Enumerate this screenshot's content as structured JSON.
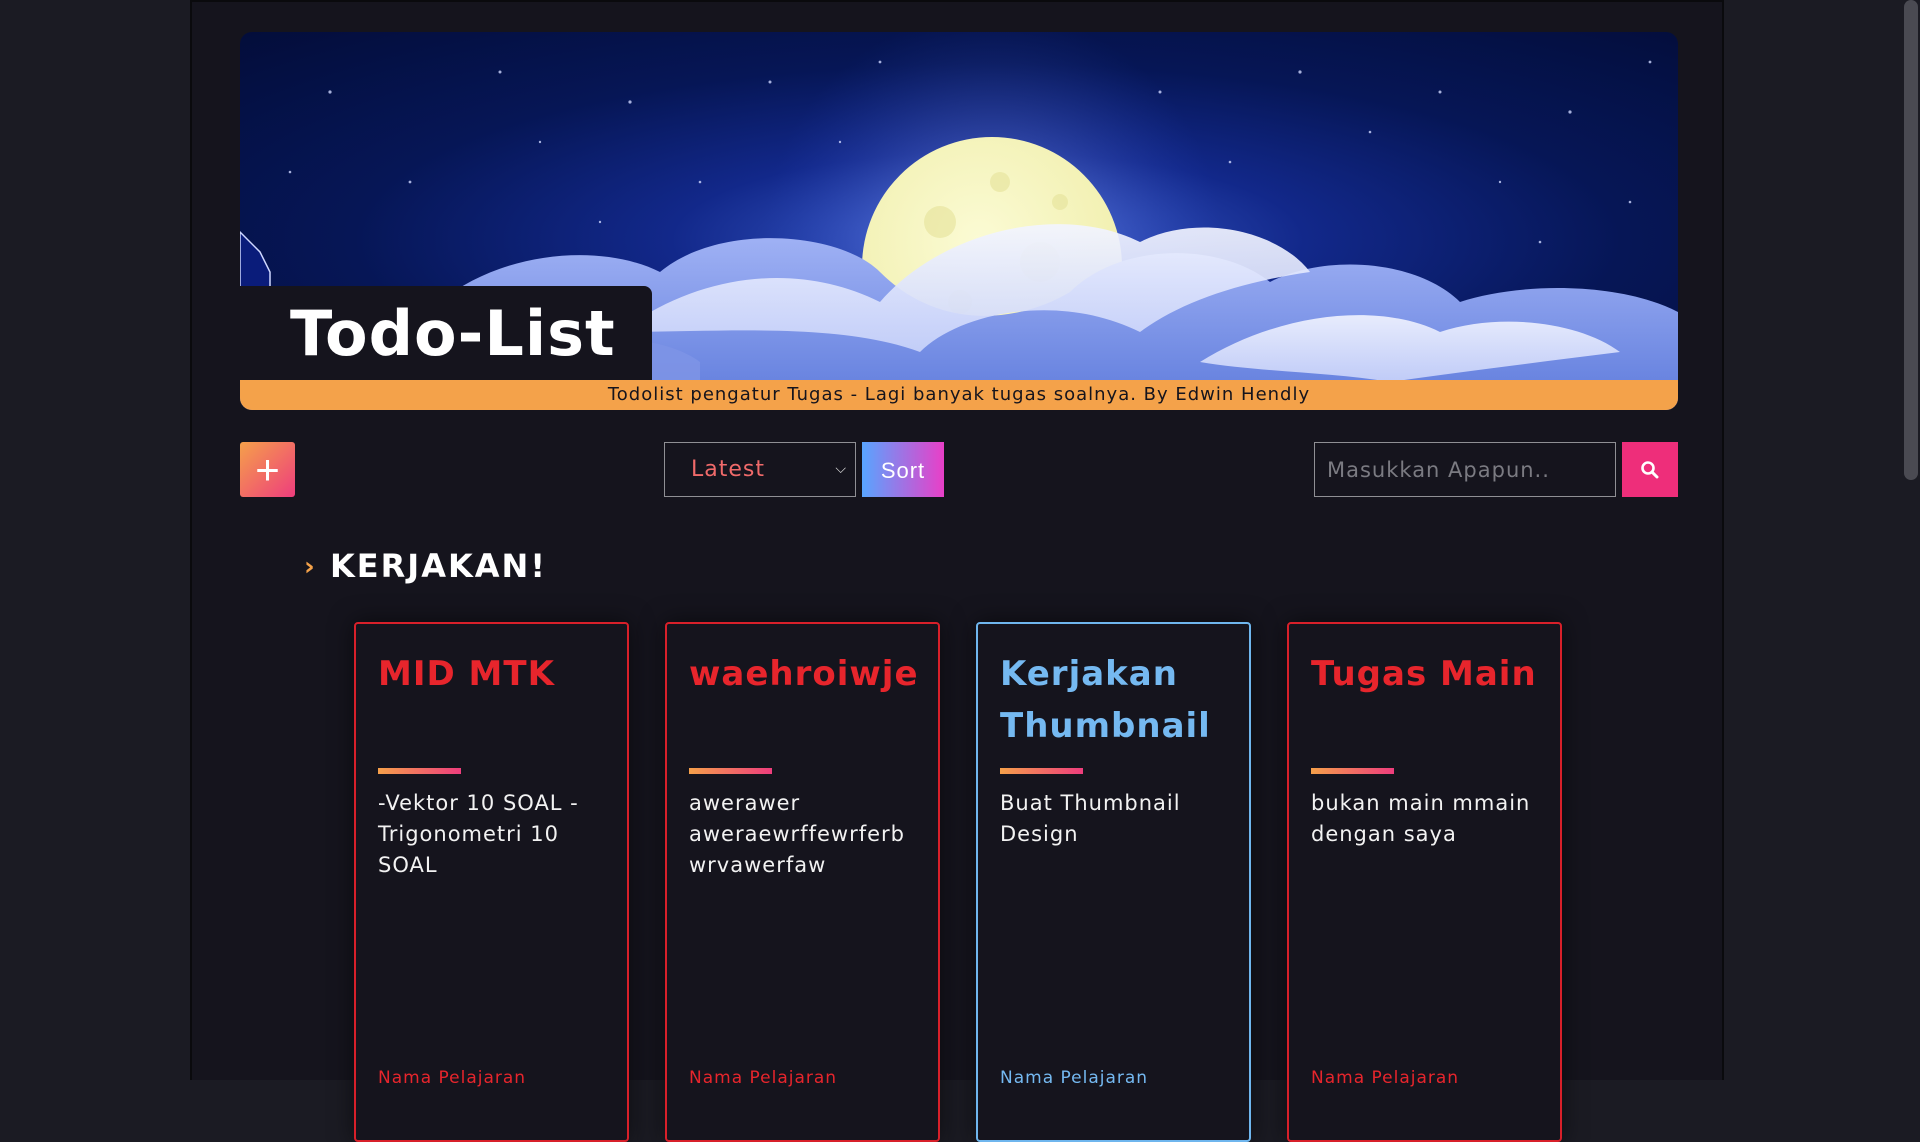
{
  "banner": {
    "title": "Todo-List",
    "tagline": "Todolist pengatur Tugas - Lagi banyak tugas soalnya. By Edwin Hendly"
  },
  "toolbar": {
    "add_icon": "plus-icon",
    "add_label": "+",
    "sort_selected": "Latest",
    "sort_button_label": "Sort",
    "search_placeholder": "Masukkan Apapun..",
    "search_icon": "search-icon"
  },
  "section": {
    "title": "KERJAKAN!"
  },
  "cards": [
    {
      "title": "MID MTK",
      "description": "-Vektor 10 SOAL -Trigonometri 10 SOAL",
      "subject": "Nama Pelajaran",
      "color": "#e7252c"
    },
    {
      "title": "waehroiwje",
      "description": "awerawer aweraewrffewrferb wrvawerfaw",
      "subject": "Nama Pelajaran",
      "color": "#e7252c"
    },
    {
      "title": "Kerjakan Thumbnail",
      "description": "Buat Thumbnail Design",
      "subject": "Nama Pelajaran",
      "color": "#75b9f1"
    },
    {
      "title": "Tugas Main",
      "description": "bukan main mmain dengan saya",
      "subject": "Nama Pelajaran",
      "color": "#e7252c"
    }
  ],
  "colors": {
    "accent_orange": "#f4a24a",
    "accent_pink": "#ee2e7a",
    "background": "#15141d"
  }
}
